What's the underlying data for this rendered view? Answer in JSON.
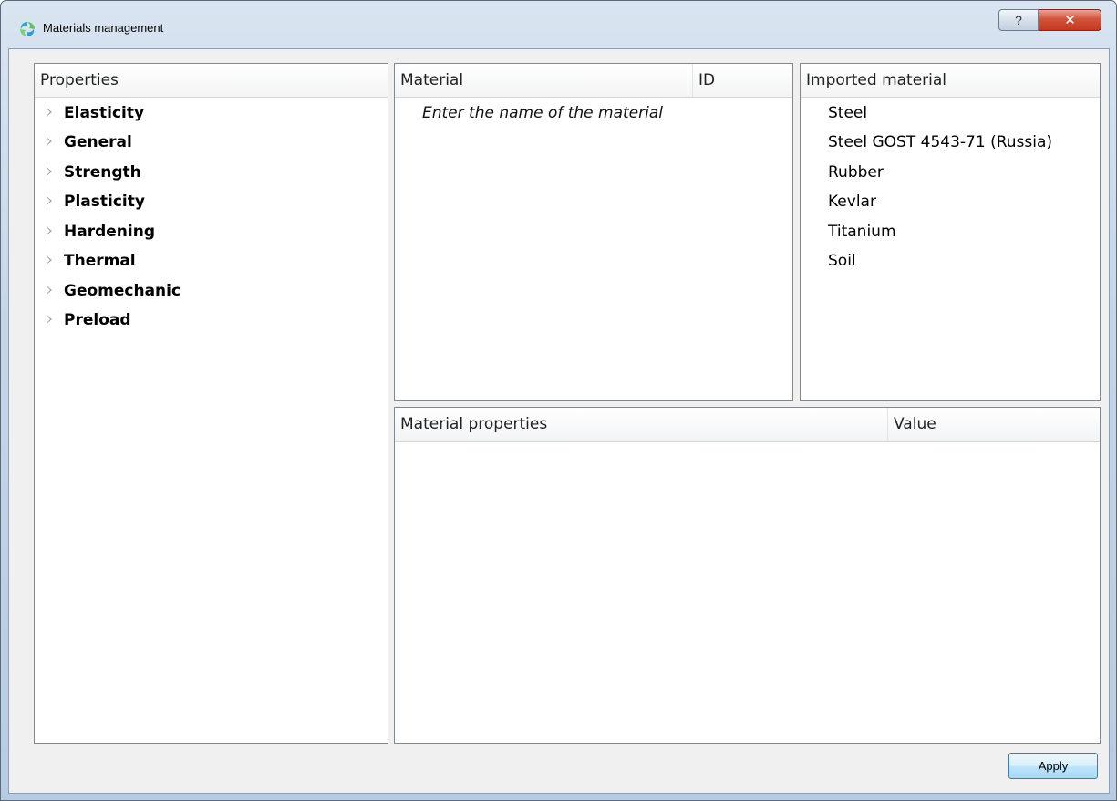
{
  "window": {
    "title": "Materials management"
  },
  "titlebar": {
    "help_glyph": "?",
    "close_glyph": "✕"
  },
  "properties_panel": {
    "header": "Properties",
    "items": [
      {
        "label": "Elasticity"
      },
      {
        "label": "General"
      },
      {
        "label": "Strength"
      },
      {
        "label": "Plasticity"
      },
      {
        "label": "Hardening"
      },
      {
        "label": "Thermal"
      },
      {
        "label": "Geomechanic"
      },
      {
        "label": "Preload"
      }
    ]
  },
  "material_panel": {
    "headers": [
      "Material",
      "ID"
    ],
    "placeholder": "Enter the name of the material"
  },
  "imported_panel": {
    "header": "Imported material",
    "items": [
      {
        "label": "Steel"
      },
      {
        "label": "Steel GOST 4543-71 (Russia)"
      },
      {
        "label": "Rubber"
      },
      {
        "label": "Kevlar"
      },
      {
        "label": "Titanium"
      },
      {
        "label": "Soil"
      }
    ]
  },
  "properties_table": {
    "headers": [
      "Material properties",
      "Value"
    ]
  },
  "footer": {
    "apply_label": "Apply"
  },
  "icons": {
    "app": "materials-app-icon",
    "help": "help-icon",
    "close": "close-icon",
    "expand": "expand-arrow-icon"
  },
  "colors": {
    "titlebar": "#c6d6e9",
    "close_button": "#c23a22",
    "client_bg": "#f0f0f0",
    "apply_border": "#3c7fb1"
  }
}
